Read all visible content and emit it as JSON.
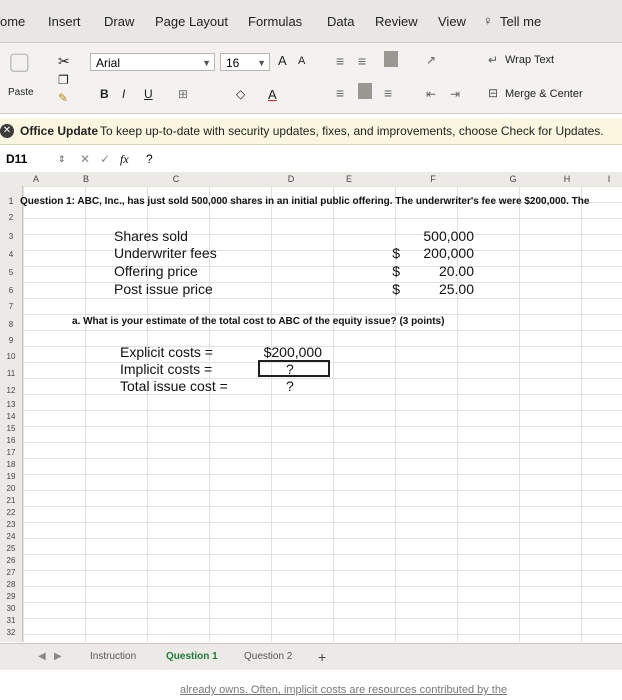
{
  "tabs": [
    "ome",
    "Insert",
    "Draw",
    "Page Layout",
    "Formulas",
    "Data",
    "Review",
    "View",
    "Tell me"
  ],
  "ribbon": {
    "paste_label": "Paste",
    "font_name": "Arial",
    "font_size": "16",
    "grow_font": "A",
    "shrink_font": "A",
    "bold": "B",
    "italic": "I",
    "underline": "U",
    "font_color": "A",
    "wrap_text": "Wrap Text",
    "merge_center": "Merge & Center"
  },
  "notification": {
    "title": "Office Update",
    "message": "To keep up-to-date with security updates, fixes, and improvements, choose Check for Updates."
  },
  "formula_bar": {
    "cell_ref": "D11",
    "cancel": "✕",
    "confirm": "✓",
    "fx": "fx",
    "value": "?"
  },
  "columns": [
    "A",
    "B",
    "C",
    "D",
    "E",
    "F",
    "G",
    "H",
    "I"
  ],
  "rows": [
    "1",
    "2",
    "3",
    "4",
    "5",
    "6",
    "7",
    "8",
    "9",
    "10",
    "11",
    "12",
    "13",
    "14",
    "15",
    "16",
    "17",
    "18",
    "19",
    "20",
    "21",
    "22",
    "23",
    "24",
    "25",
    "26",
    "27",
    "28",
    "29",
    "30",
    "31",
    "32"
  ],
  "sheet": {
    "question": "Question 1: ABC, Inc., has just sold 500,000 shares in an initial public offering. The underwriter's fee were $200,000. The",
    "items": [
      {
        "label": "Shares sold",
        "dollar": "",
        "value": "500,000"
      },
      {
        "label": "Underwriter fees",
        "dollar": "$",
        "value": "200,000"
      },
      {
        "label": "Offering price",
        "dollar": "$",
        "value": "20.00"
      },
      {
        "label": "Post issue price",
        "dollar": "$",
        "value": "25.00"
      }
    ],
    "part_a": "a. What is your estimate of the total cost to ABC of the equity issue? (3 points)",
    "answers": [
      {
        "label": "Explicit costs =",
        "value": "$200,000"
      },
      {
        "label": "Implicit costs =",
        "value": "?"
      },
      {
        "label": "Total issue cost =",
        "value": "?"
      }
    ]
  },
  "sheet_tabs": [
    "Instruction",
    "Question 1",
    "Question 2"
  ],
  "add_sheet": "+",
  "bottom_text": "already owns. Often, implicit costs are resources contributed by the"
}
